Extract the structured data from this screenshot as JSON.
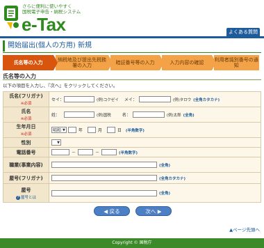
{
  "header": {
    "logo_tagline_1": "さらに便利に使いやすく",
    "logo_tagline_2": "国税電子申告・納税システム",
    "logo_name": "e-Tax",
    "faq_label": "よくある質問"
  },
  "page": {
    "title": "開始届出(個人の方用)  新規"
  },
  "steps": [
    {
      "label": "氏名等の入力",
      "active": true
    },
    {
      "label": "納税地及び提出先税務署の入力",
      "active": false
    },
    {
      "label": "暗証番号等の入力",
      "active": false
    },
    {
      "label": "入力内容の確認",
      "active": false
    },
    {
      "label": "利用者識別番号の通知",
      "active": false
    }
  ],
  "section": {
    "title": "氏名等の入力",
    "intro": "以下の項目を入力し、『次へ』をクリックしてください。"
  },
  "form": {
    "required_label": "※必須",
    "name_kana": {
      "label": "氏名(フリガナ)",
      "sei_label": "セイ：",
      "sei_example": "(例)コクゼイ",
      "mei_label": "メイ：",
      "mei_example": "(例)タロウ",
      "hint": "(全角カタカナ)"
    },
    "name": {
      "label": "氏名",
      "sei_label": "姓：",
      "sei_example": "(例)国税",
      "mei_label": "名：",
      "mei_example": "(例)太郎",
      "hint": "(全角)"
    },
    "birth": {
      "label": "生年月日",
      "era": "昭和",
      "year_unit": "年",
      "month_unit": "月",
      "day_unit": "日",
      "hint": "(半角数字)"
    },
    "gender": {
      "label": "性別"
    },
    "phone": {
      "label": "電話番号",
      "sep": "－",
      "hint": "(半角数字)"
    },
    "occupation": {
      "label": "職業(事業内容)",
      "hint": "(全角)"
    },
    "shop_kana": {
      "label": "屋号(フリガナ)",
      "hint": "(全角カタカナ)"
    },
    "shop": {
      "label": "屋号",
      "help": "屋号とは",
      "hint": "(全角)"
    }
  },
  "buttons": {
    "back": "戻る",
    "next": "次へ"
  },
  "page_top": "ページ先頭へ",
  "footer": "Copyright © 国税庁",
  "colors": {
    "brand_green": "#2f8a1e",
    "brand_blue": "#1e5b9a",
    "step_active": "#d9540d",
    "step_inactive": "#f4a248"
  }
}
